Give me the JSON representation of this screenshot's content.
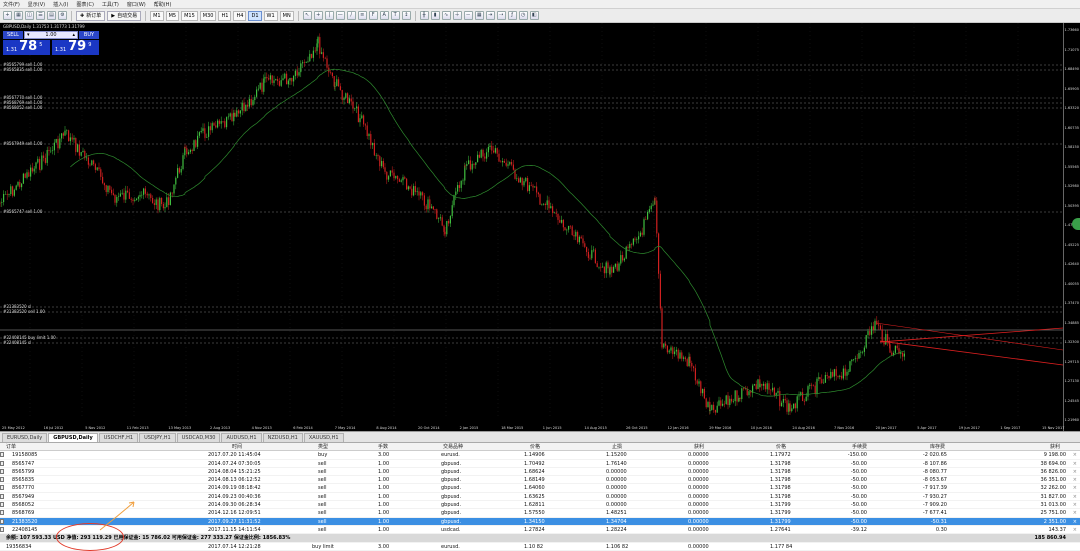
{
  "menu": [
    "文件(F)",
    "显示(V)",
    "插入(I)",
    "图表(C)",
    "工具(T)",
    "窗口(W)",
    "帮助(H)"
  ],
  "toolbar": {
    "new_order": "新订单",
    "autotrade": "自动交易",
    "timeframes": [
      "M1",
      "M5",
      "M15",
      "M30",
      "H1",
      "H4",
      "D1",
      "W1",
      "MN"
    ],
    "active_timeframe": "D1"
  },
  "chart": {
    "title": "GBPUSD,Daily 1.31753 1.31773 1.31799",
    "one_click": {
      "sell_label": "SELL",
      "buy_label": "BUY",
      "lot": "1.00",
      "sell_small": "1.31",
      "sell_big": "78",
      "sell_sup": "5",
      "buy_small": "1.31",
      "buy_big": "79",
      "buy_sup": "9"
    },
    "level_labels": [
      "#8565799 sell 1.00",
      "#8565835 sell 1.00",
      "#8567770 sell 1.00",
      "#8568769 sell 1.00",
      "#8568052 sell 1.00",
      "#8567949 sell 1.00",
      "#8565747 sell 1.00",
      "#21383520 sl",
      "#21383520 sell 1.00",
      "#22408145 buy limit 1.00",
      "#22408145 sl"
    ],
    "y_ticks": [
      "1.73660",
      "1.71075",
      "1.68490",
      "1.65905",
      "1.63320",
      "1.60735",
      "1.58150",
      "1.55565",
      "1.52980",
      "1.50395",
      "1.47810",
      "1.45225",
      "1.42640",
      "1.40055",
      "1.37470",
      "1.34885",
      "1.32300",
      "1.29715",
      "1.27130",
      "1.24545",
      "1.21960"
    ],
    "x_ticks": [
      "25 May 2012",
      "16 Jul 2012",
      "5 Nov 2012",
      "11 Feb 2013",
      "13 May 2013",
      "2 Aug 2013",
      "4 Nov 2013",
      "6 Feb 2014",
      "7 May 2014",
      "8 Aug 2014",
      "20 Oct 2014",
      "2 Jan 2015",
      "18 Mar 2015",
      "1 Jun 2015",
      "14 Aug 2015",
      "26 Oct 2015",
      "12 Jan 2016",
      "29 Mar 2016",
      "10 Jun 2016",
      "24 Aug 2016",
      "7 Nov 2016",
      "20 Jan 2017",
      "5 Apr 2017",
      "19 Jun 2017",
      "1 Sep 2017",
      "15 Nov 2017"
    ]
  },
  "tabs": [
    "EURUSD,Daily",
    "GBPUSD,Daily",
    "USDCHF,H1",
    "USDJPY,H1",
    "USDCAD,M30",
    "AUDUSD,H1",
    "NZDUSD,H1",
    "XAUUSD,H1"
  ],
  "active_tab": "GBPUSD,Daily",
  "orders": {
    "headers": [
      "订单",
      "时间",
      "类型",
      "手数",
      "交易品种",
      "价格",
      "止损",
      "获利",
      "价格",
      "手续费",
      "库存费",
      "获利"
    ],
    "rows": [
      [
        "19158085",
        "2017.07.20 11:45:04",
        "buy",
        "3.00",
        "eurusd.",
        "1.14906",
        "1.15200",
        "0.00000",
        "1.17972",
        "-150.00",
        "-2 020.65",
        "9 198.00"
      ],
      [
        "8565747",
        "2014.07.24 07:30:05",
        "sell",
        "1.00",
        "gbpusd.",
        "1.70492",
        "1.76140",
        "0.00000",
        "1.31798",
        "-50.00",
        "-8 107.86",
        "38 694.00"
      ],
      [
        "8565799",
        "2014.08.04 15:21:25",
        "sell",
        "1.00",
        "gbpusd.",
        "1.68624",
        "0.00000",
        "0.00000",
        "1.31798",
        "-50.00",
        "-8 080.77",
        "36 826.00"
      ],
      [
        "8565835",
        "2014.08.13 06:12:52",
        "sell",
        "1.00",
        "gbpusd.",
        "1.68149",
        "0.00000",
        "0.00000",
        "1.31798",
        "-50.00",
        "-8 053.67",
        "36 351.00"
      ],
      [
        "8567770",
        "2014.09.19 08:18:42",
        "sell",
        "1.00",
        "gbpusd.",
        "1.64060",
        "0.00000",
        "0.00000",
        "1.31798",
        "-50.00",
        "-7 917.39",
        "32 262.00"
      ],
      [
        "8567949",
        "2014.09.23 00:40:36",
        "sell",
        "1.00",
        "gbpusd.",
        "1.63625",
        "0.00000",
        "0.00000",
        "1.31798",
        "-50.00",
        "-7 930.27",
        "31 827.00"
      ],
      [
        "8568052",
        "2014.09.30 06:28:34",
        "sell",
        "1.00",
        "gbpusd.",
        "1.62811",
        "0.00000",
        "0.00000",
        "1.31799",
        "-50.00",
        "-7 909.20",
        "31 013.00"
      ],
      [
        "8568769",
        "2014.12.16 12:09:51",
        "sell",
        "1.00",
        "gbpusd.",
        "1.57550",
        "1.48251",
        "0.00000",
        "1.31799",
        "-50.00",
        "-7 677.41",
        "25 751.00"
      ],
      [
        "21383520",
        "2017.09.27 11:31:52",
        "sell",
        "1.00",
        "gbpusd.",
        "1.34150",
        "1.34704",
        "0.00000",
        "1.31799",
        "-50.00",
        "-50.31",
        "2 351.00"
      ],
      [
        "22408145",
        "2017.11.15 14:11:54",
        "sell",
        "1.00",
        "usdcad.",
        "1.27824",
        "1.28224",
        "0.00000",
        "1.27641",
        "-39.12",
        "0.30",
        "143.37"
      ]
    ],
    "selected_index": 8,
    "balance_line": "余额: 107 593.33 USD  净值: 293 119.29  已用保证金: 15 786.02  可用保证金: 277 333.27  保证金比例: 1856.83%",
    "balance_profit": "185 860.94",
    "last_row": [
      "19356834",
      "2017.07.14 12:21:28",
      "buy limit",
      "3.00",
      "eurusd.",
      "1.10 82",
      "1.106 82",
      "0.00000",
      "1.177 84"
    ]
  }
}
